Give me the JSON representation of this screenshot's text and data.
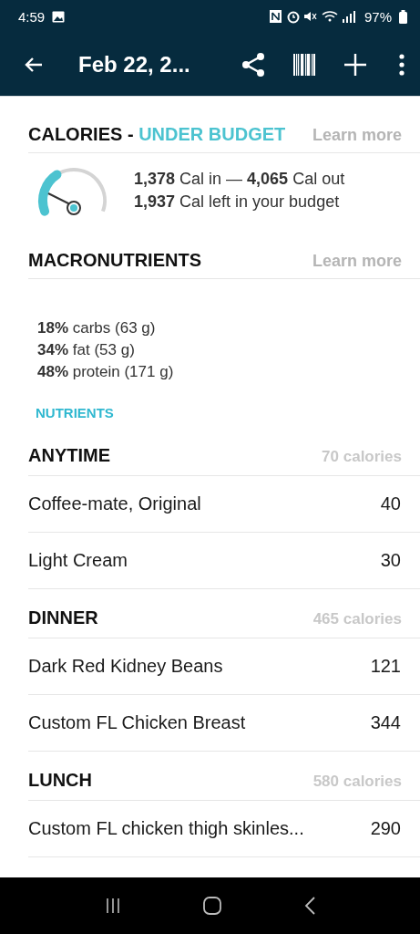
{
  "status_bar": {
    "time": "4:59",
    "battery": "97%"
  },
  "toolbar": {
    "title": "Feb 22, 2..."
  },
  "calories": {
    "title": "CALORIES - ",
    "status": "UNDER BUDGET",
    "link": "Learn more",
    "lines": [
      "**1,378** Cal in — **4,065** Cal out",
      "**1,937** Cal left in your budget"
    ]
  },
  "macronutrients": {
    "title": "MACRONUTRIENTS",
    "link": "Learn more",
    "lines": [
      "**18%** carbs (63 g)",
      "**34%** fat (53 g)",
      "**48%** protein (171 g)"
    ],
    "nutrients_link": "NUTRIENTS"
  },
  "meals": [
    {
      "name": "ANYTIME",
      "total": "70 calories",
      "items": [
        {
          "name": "Coffee-mate, Original",
          "calories": "40"
        },
        {
          "name": "Light Cream",
          "calories": "30"
        }
      ]
    },
    {
      "name": "DINNER",
      "total": "465 calories",
      "items": [
        {
          "name": "Dark Red Kidney Beans",
          "calories": "121"
        },
        {
          "name": "Custom FL Chicken Breast",
          "calories": "344"
        }
      ]
    },
    {
      "name": "LUNCH",
      "total": "580 calories",
      "items": [
        {
          "name": "Custom FL chicken thigh skinles...",
          "calories": "290"
        }
      ]
    }
  ]
}
